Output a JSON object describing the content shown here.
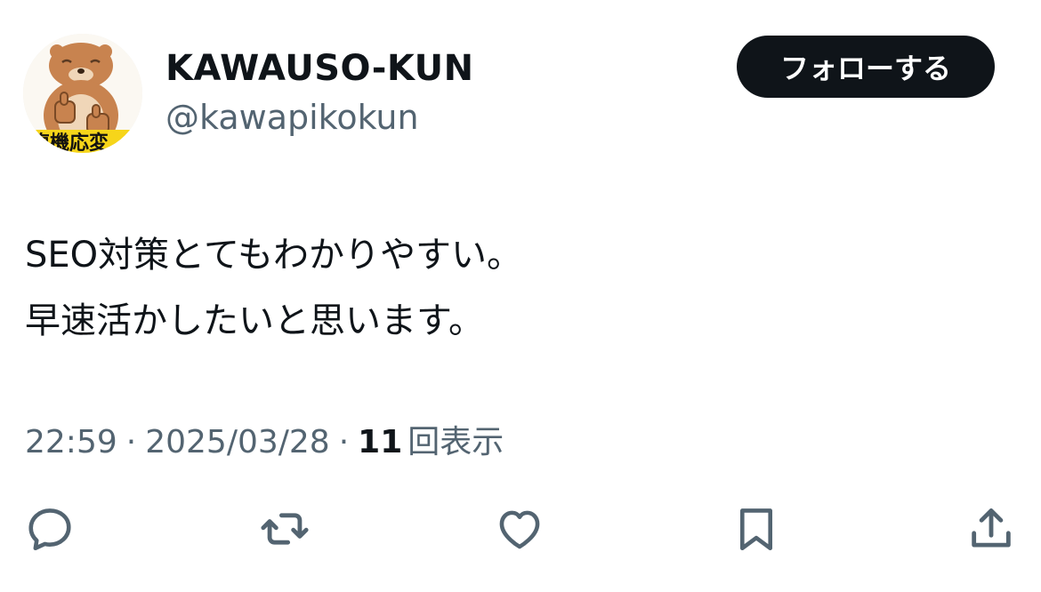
{
  "profile": {
    "display_name": "KAWAUSO-KUN",
    "handle": "@kawapikokun",
    "avatar_banner_text": "臨機応変"
  },
  "follow_button": {
    "label": "フォローする"
  },
  "tweet": {
    "lines": [
      "SEO対策とてもわかりやすい。",
      "早速活かしたいと思います。"
    ]
  },
  "meta": {
    "time": "22:59",
    "separator": "·",
    "date": "2025/03/28",
    "views_count": "11",
    "views_label": "回表示"
  },
  "actions": {
    "icons": [
      "reply-icon",
      "retweet-icon",
      "like-icon",
      "bookmark-icon",
      "share-icon"
    ]
  },
  "colors": {
    "text_primary": "#0f1419",
    "text_secondary": "#536471",
    "follow_bg": "#0f1419",
    "icon": "#536471"
  }
}
